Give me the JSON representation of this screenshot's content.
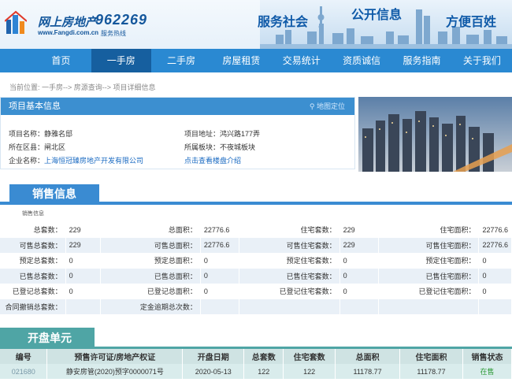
{
  "header": {
    "logo_title": "网上房地产",
    "logo_url": "www.Fangdi.com.cn",
    "hotline_number": "962269",
    "hotline_label": "服务热线",
    "slogans": [
      "服务社会",
      "公开信息",
      "方便百姓"
    ]
  },
  "nav": [
    "首页",
    "一手房",
    "二手房",
    "房屋租赁",
    "交易统计",
    "资质诚信",
    "服务指南",
    "关于我们"
  ],
  "nav_active": "一手房",
  "breadcrumb": "当前位置: 一手房--> 房源查询--> 项目详细信息",
  "project": {
    "header": "项目基本信息",
    "map_link": "地图定位",
    "name_label": "项目名称：",
    "name": "静雅名邸",
    "address_label": "项目地址：",
    "address": "鸿兴路177弄",
    "district_label": "所在区县：",
    "district": "闸北区",
    "block_label": "所属板块：",
    "block": "不夜城板块",
    "company_label": "企业名称：",
    "company": "上海恒冠臻房地产开发有限公司",
    "intro_link": "点击查看楼盘介绍"
  },
  "sales": {
    "title": "销售信息",
    "sub_label": "销售信息",
    "rows": [
      [
        [
          "总套数：",
          "229"
        ],
        [
          "总面积：",
          "22776.6"
        ],
        [
          "住宅套数：",
          "229"
        ],
        [
          "住宅面积：",
          "22776.6"
        ]
      ],
      [
        [
          "可售总套数：",
          "229"
        ],
        [
          "可售总面积：",
          "22776.6"
        ],
        [
          "可售住宅套数：",
          "229"
        ],
        [
          "可售住宅面积：",
          "22776.6"
        ]
      ],
      [
        [
          "预定总套数：",
          "0"
        ],
        [
          "预定总面积：",
          "0"
        ],
        [
          "预定住宅套数：",
          "0"
        ],
        [
          "预定住宅面积：",
          "0"
        ]
      ],
      [
        [
          "已售总套数：",
          "0"
        ],
        [
          "已售总面积：",
          "0"
        ],
        [
          "已售住宅套数：",
          "0"
        ],
        [
          "已售住宅面积：",
          "0"
        ]
      ],
      [
        [
          "已登记总套数：",
          "0"
        ],
        [
          "已登记总面积：",
          "0"
        ],
        [
          "已登记住宅套数：",
          "0"
        ],
        [
          "已登记住宅面积：",
          "0"
        ]
      ],
      [
        [
          "合同撤销总套数：",
          ""
        ],
        [
          "定金逾期总次数：",
          ""
        ],
        [
          "",
          ""
        ],
        [
          "",
          ""
        ]
      ]
    ]
  },
  "open_units": {
    "title": "开盘单元",
    "columns": [
      "编号",
      "预售许可证/房地产权证",
      "开盘日期",
      "总套数",
      "住宅套数",
      "总面积",
      "住宅面积",
      "销售状态"
    ],
    "rows": [
      [
        "021680",
        "静安房管(2020)预字0000071号",
        "2020-05-13",
        "122",
        "122",
        "11178.77",
        "11178.77",
        "在售"
      ]
    ]
  },
  "colors": {
    "nav": "#2a89d2",
    "nav_active": "#165f9f",
    "section": "#3a8bd2",
    "open_section": "#4fa5a5",
    "status_green": "#2e9a37"
  }
}
